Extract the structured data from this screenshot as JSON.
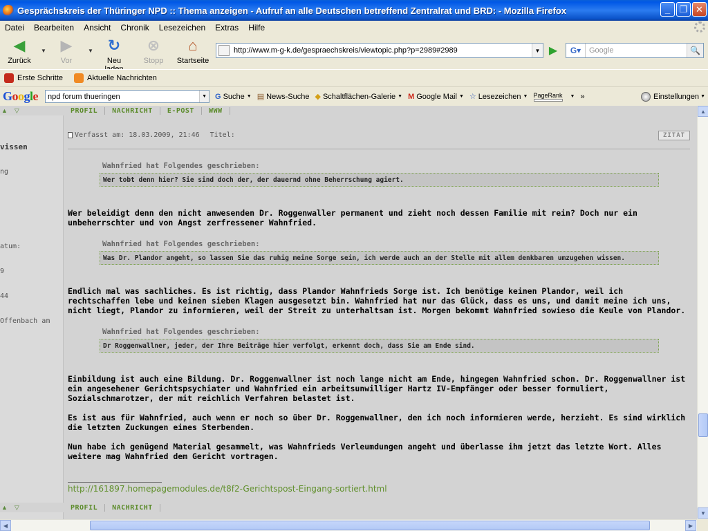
{
  "window": {
    "title": "Gesprächskreis der Thüringer NPD :: Thema anzeigen - Aufruf an alle Deutschen betreffend Zentralrat und BRD: - Mozilla Firefox"
  },
  "menu": [
    "Datei",
    "Bearbeiten",
    "Ansicht",
    "Chronik",
    "Lesezeichen",
    "Extras",
    "Hilfe"
  ],
  "nav": {
    "back": "Zurück",
    "forward": "Vor",
    "reload": "Neu laden",
    "stop": "Stopp",
    "home": "Startseite",
    "url": "http://www.m-g-k.de/gespraechskreis/viewtopic.php?p=2989#2989",
    "search_placeholder": "Google"
  },
  "bookmarks": [
    "Erste Schritte",
    "Aktuelle Nachrichten"
  ],
  "google_toolbar": {
    "logo": "Google",
    "query": "npd forum thueringen",
    "items": [
      "Suche",
      "News-Suche",
      "Schaltflächen-Galerie",
      "Google Mail",
      "Lesezeichen",
      "PageRank"
    ],
    "more": "»",
    "settings": "Einstellungen"
  },
  "profile_bar": {
    "top": [
      "PROFIL",
      "NACHRICHT",
      "E-POST",
      "WWW"
    ],
    "bottom": [
      "PROFIL",
      "NACHRICHT"
    ]
  },
  "poster": {
    "name": "vissen",
    "lines": [
      "ng",
      "",
      "",
      "atum:",
      "9",
      "44",
      "Offenbach am"
    ]
  },
  "post": {
    "posted": "Verfasst am: 18.03.2009, 21:46",
    "title_label": "Titel:",
    "quote_button": "ZITAT",
    "quotes": [
      {
        "author_line": "Wahnfried hat Folgendes geschrieben:",
        "text": "Wer tobt denn hier? Sie sind doch der, der dauernd ohne Beherrschung agiert."
      },
      {
        "author_line": "Wahnfried hat Folgendes geschrieben:",
        "text": "Was Dr. Plandor angeht, so lassen Sie das ruhig meine Sorge sein, ich werde auch an der Stelle mit allem denkbaren umzugehen wissen."
      },
      {
        "author_line": "Wahnfried hat Folgendes geschrieben:",
        "text": "Dr Roggenwallner, jeder, der Ihre Beiträge hier verfolgt, erkennt doch, dass Sie am Ende sind."
      }
    ],
    "paragraphs": [
      "Wer beleidigt denn den nicht anwesenden Dr. Roggenwaller permanent und zieht noch dessen Familie mit rein? Doch nur ein unbeherrschter und von Angst zerfressener Wahnfried.",
      "Endlich mal was sachliches. Es ist richtig, dass Plandor Wahnfrieds Sorge ist. Ich benötige keinen Plandor, weil ich rechtschaffen lebe und keinen sieben Klagen ausgesetzt bin. Wahnfried hat nur das Glück, dass es uns, und damit meine ich uns, nicht liegt, Plandor zu informieren, weil der Streit zu unterhaltsam ist. Morgen bekommt Wahnfried sowieso die Keule von Plandor.",
      "Einbildung ist auch eine Bildung. Dr. Roggenwallner ist noch lange nicht am Ende, hingegen Wahnfried schon. Dr. Roggenwallner ist ein angesehener Gerichtspsychiater und Wahnfried ein arbeitsunwilliger Hartz IV-Empfänger oder besser formuliert, Sozialschmarotzer, der mit reichlich Verfahren belastet ist.",
      "Es ist aus für Wahnfried, auch wenn er noch so über Dr. Roggenwallner, den ich noch informieren werde, herzieht. Es sind wirklich die letzten Zuckungen eines Sterbenden.",
      "Nun habe ich genügend Material gesammelt, was Wahnfrieds Verleumdungen angeht und überlasse ihm jetzt das letzte Wort. Alles weitere mag Wahnfried dem Gericht vortragen."
    ],
    "signature_link": "http://161897.homepagemodules.de/t8f2-Gerichtspost-Eingang-sortiert.html"
  }
}
